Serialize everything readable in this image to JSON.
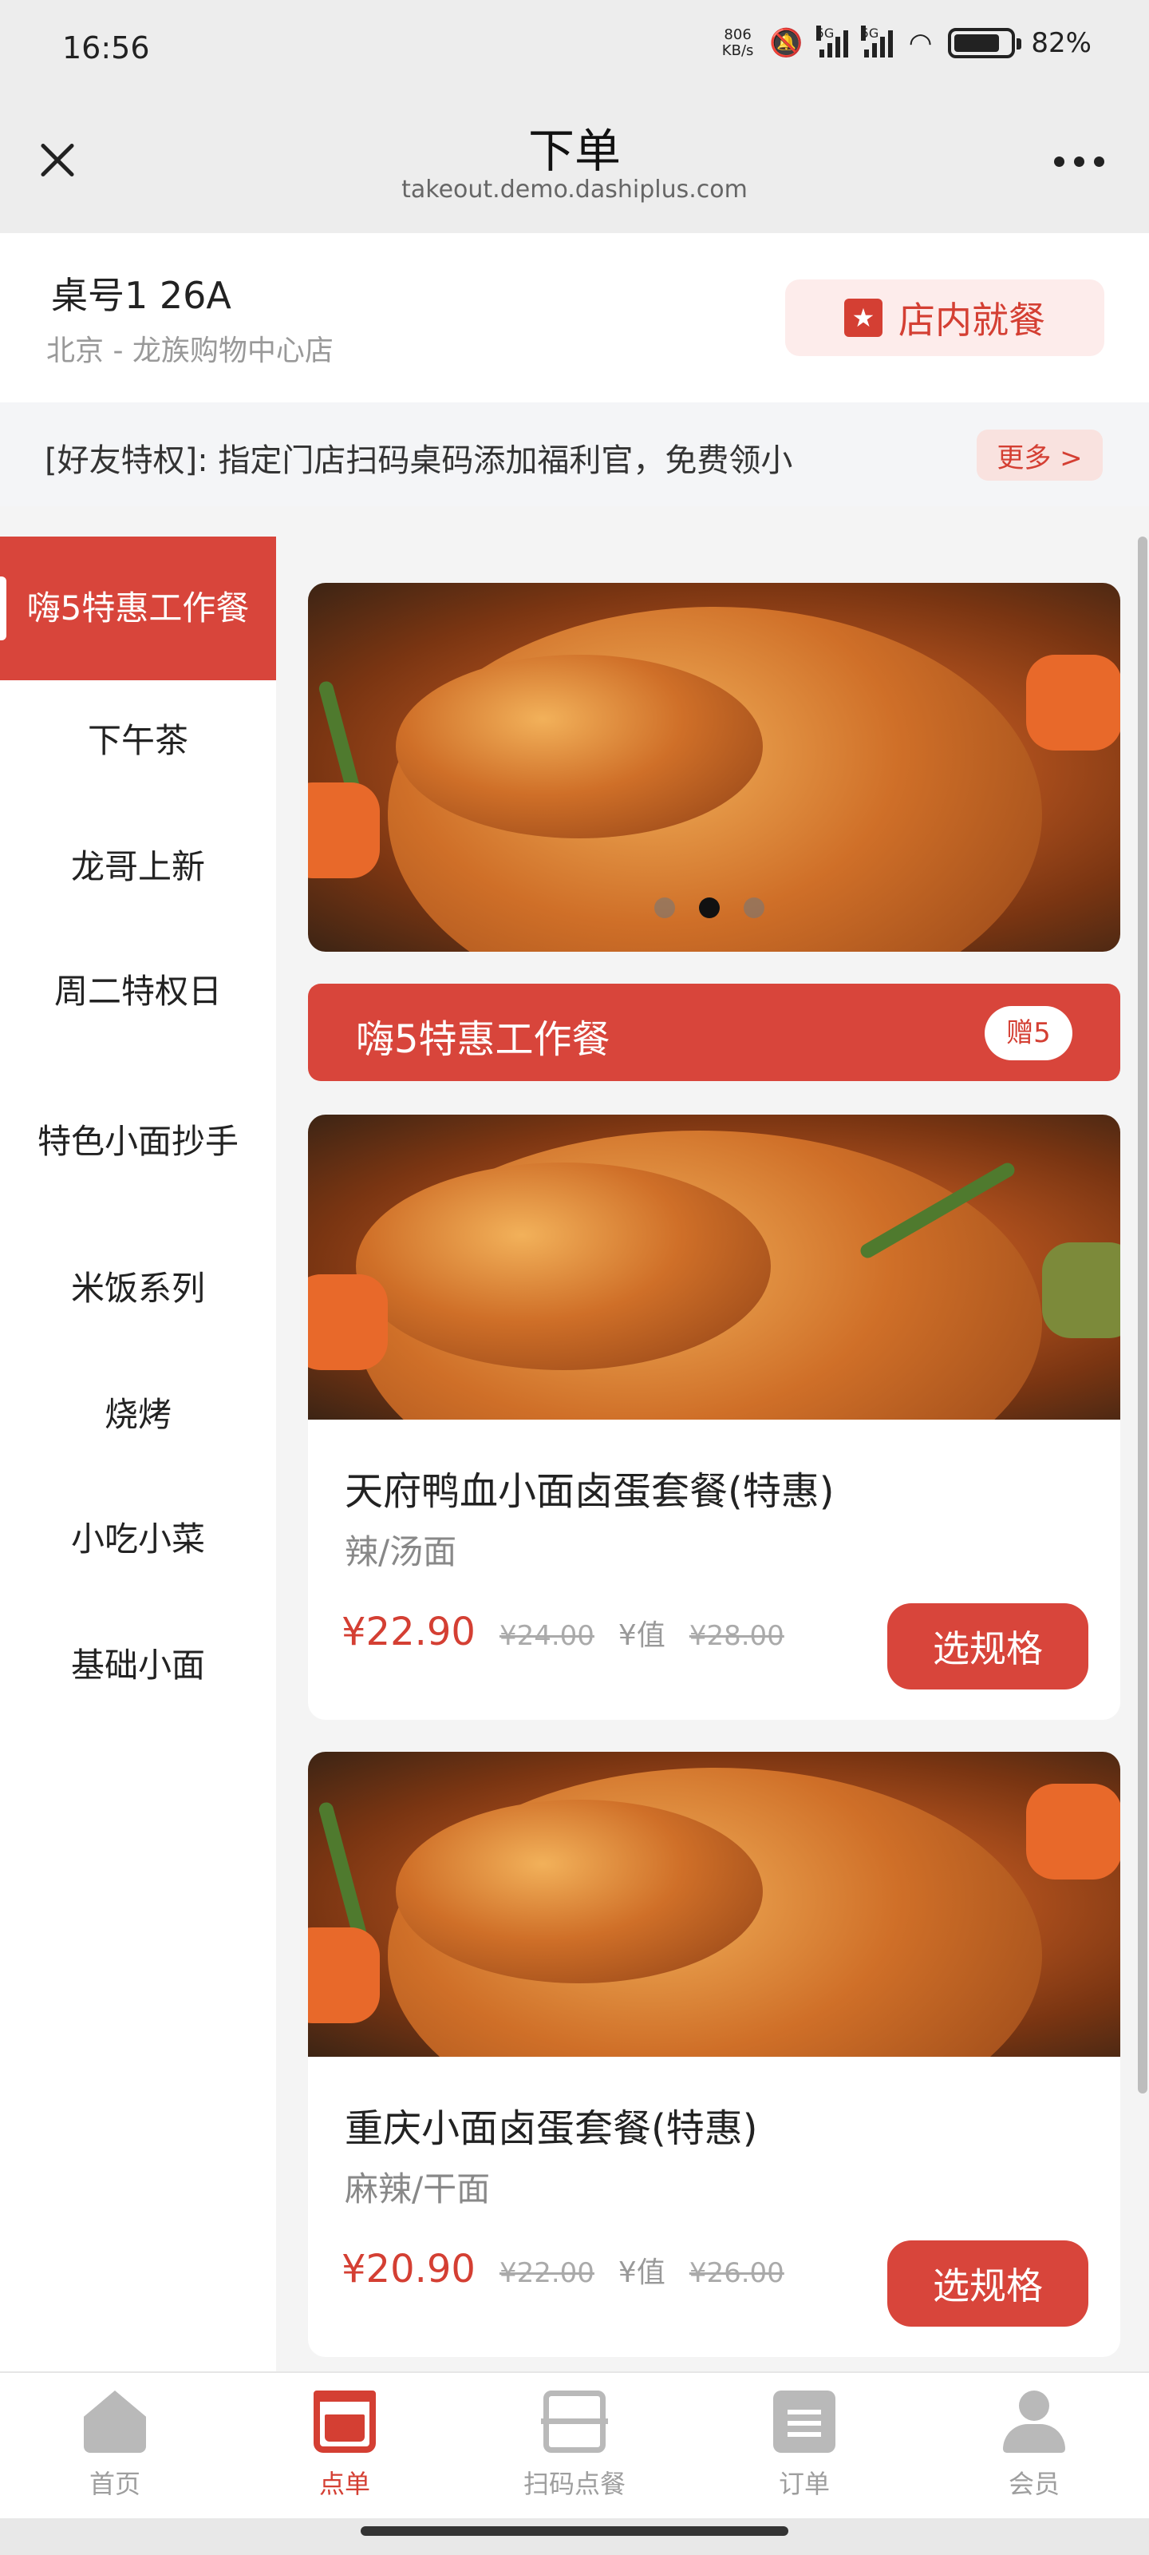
{
  "status_bar": {
    "time": "16:56",
    "net_speed_value": "806",
    "net_speed_unit": "KB/s",
    "signal_1": "5G",
    "signal_2": "5G",
    "battery": "82%"
  },
  "nav": {
    "title": "下单",
    "url": "takeout.demo.dashiplus.com"
  },
  "table": {
    "number": "桌号1 26A",
    "store": "北京 - 龙族购物中心店",
    "dine_in_label": "店内就餐"
  },
  "notice": {
    "text": "[好友特权]: 指定门店扫码桌码添加福利官，免费领小",
    "more_label": "更多 >"
  },
  "categories": [
    "嗨5特惠工作餐",
    "下午茶",
    "龙哥上新",
    "周二特权日",
    "特色小面抄手",
    "米饭系列",
    "烧烤",
    "小吃小菜",
    "基础小面"
  ],
  "section": {
    "title": "嗨5特惠工作餐",
    "badge": "赠5"
  },
  "dishes": [
    {
      "name": "天府鸭血小面卤蛋套餐(特惠)",
      "tag": "辣/汤面",
      "price": "¥22.90",
      "original_price": "¥24.00",
      "value_label": "¥值",
      "value_price": "¥28.00",
      "button": "选规格"
    },
    {
      "name": "重庆小面卤蛋套餐(特惠)",
      "tag": "麻辣/干面",
      "price": "¥20.90",
      "original_price": "¥22.00",
      "value_label": "¥值",
      "value_price": "¥26.00",
      "button": "选规格"
    }
  ],
  "tabbar": [
    {
      "label": "首页",
      "icon": "home-icon"
    },
    {
      "label": "点单",
      "icon": "cup-icon"
    },
    {
      "label": "扫码点餐",
      "icon": "scan-icon"
    },
    {
      "label": "订单",
      "icon": "clipboard-icon"
    },
    {
      "label": "会员",
      "icon": "user-icon"
    }
  ],
  "colors": {
    "accent": "#d8453b",
    "accent_light": "#fdeceb"
  }
}
